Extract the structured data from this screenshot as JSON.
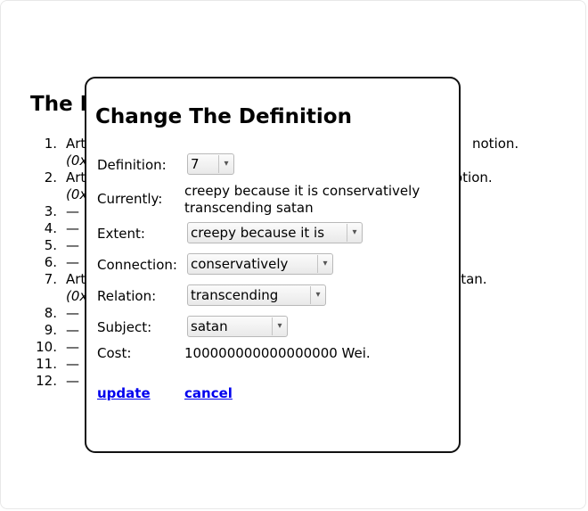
{
  "background": {
    "title_partial": "The I",
    "items": [
      {
        "num": "1.",
        "text": "Art",
        "tail": "notion.",
        "sub": "(0x"
      },
      {
        "num": "2.",
        "text": "Art",
        "tail": "otion.",
        "sub": "(0x"
      },
      {
        "num": "3.",
        "text": "—"
      },
      {
        "num": "4.",
        "text": "—"
      },
      {
        "num": "5.",
        "text": "—"
      },
      {
        "num": "6.",
        "text": "—"
      },
      {
        "num": "7.",
        "text": "Art",
        "tail": "atan.",
        "sub": "(0x"
      },
      {
        "num": "8.",
        "text": "—"
      },
      {
        "num": "9.",
        "text": "—"
      },
      {
        "num": "10.",
        "text": "—"
      },
      {
        "num": "11.",
        "text": "—"
      },
      {
        "num": "12.",
        "text": "—"
      }
    ]
  },
  "modal": {
    "title": "Change The Definition",
    "definition_label": "Definition:",
    "definition_value": "7",
    "currently_label": "Currently:",
    "currently_line1": "creepy because it is conservatively",
    "currently_line2": "transcending satan",
    "extent_label": "Extent:",
    "extent_value": "creepy because it is",
    "connection_label": "Connection:",
    "connection_value": "conservatively",
    "relation_label": "Relation:",
    "relation_value": "transcending",
    "subject_label": "Subject:",
    "subject_value": "satan",
    "cost_label": "Cost:",
    "cost_value": "100000000000000000 Wei.",
    "update_label": "update",
    "cancel_label": "cancel"
  }
}
